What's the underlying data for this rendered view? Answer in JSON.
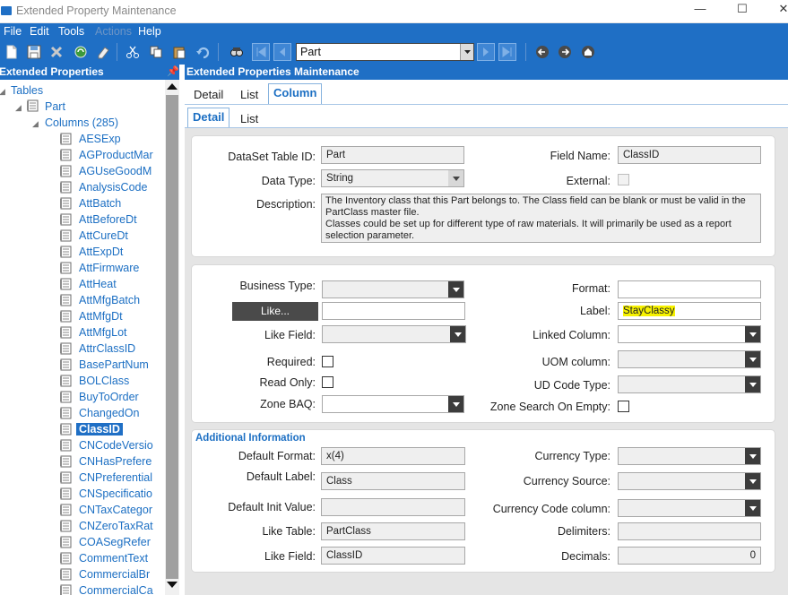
{
  "window": {
    "title": "Extended Property Maintenance",
    "minimize": "—",
    "maximize": "☐",
    "close": "✕"
  },
  "menu": [
    {
      "label": "File",
      "enabled": true
    },
    {
      "label": "Edit",
      "enabled": true
    },
    {
      "label": "Tools",
      "enabled": true
    },
    {
      "label": "Actions",
      "enabled": false
    },
    {
      "label": "Help",
      "enabled": true
    }
  ],
  "toolbar": {
    "combo_value": "Part"
  },
  "left_panel": {
    "title": "Extended Properties",
    "pin": "ᵖ"
  },
  "tree": {
    "root": "Tables",
    "table": "Part",
    "columns_node": "Columns (285)",
    "items": [
      "AESExp",
      "AGProductMar",
      "AGUseGoodM",
      "AnalysisCode",
      "AttBatch",
      "AttBeforeDt",
      "AttCureDt",
      "AttExpDt",
      "AttFirmware",
      "AttHeat",
      "AttMfgBatch",
      "AttMfgDt",
      "AttMfgLot",
      "AttrClassID",
      "BasePartNum",
      "BOLClass",
      "BuyToOrder",
      "ChangedOn",
      "ClassID",
      "CNCodeVersio",
      "CNHasPrefere",
      "CNPreferential",
      "CNSpecificatio",
      "CNTaxCategor",
      "CNZeroTaxRat",
      "COASegRefer",
      "CommentText",
      "CommercialBr",
      "CommercialCa"
    ],
    "selected": "ClassID"
  },
  "right_panel": {
    "title": "Extended Properties Maintenance"
  },
  "tabs_top": [
    {
      "label": "Detail"
    },
    {
      "label": "List"
    },
    {
      "label": "Column",
      "active": true
    }
  ],
  "tabs_sub": [
    {
      "label": "Detail",
      "active": true
    },
    {
      "label": "List"
    }
  ],
  "form": {
    "dataset_table_id_label": "DataSet Table ID:",
    "dataset_table_id": "Part",
    "field_name_label": "Field Name:",
    "field_name": "ClassID",
    "data_type_label": "Data Type:",
    "data_type": "String",
    "external_label": "External:",
    "description_label": "Description:",
    "description": "The Inventory class that this Part belongs to. The Class field can be blank or must be valid in the PartClass master file.\nClasses could be set up for different type of raw materials. It will primarily be used as a report selection parameter.",
    "business_type_label": "Business Type:",
    "business_type": "",
    "format_label": "Format:",
    "format": "",
    "like_button": "Like...",
    "like_value": "",
    "label_label": "Label:",
    "label_value": "StayClassy",
    "like_field_label": "Like Field:",
    "like_field": "",
    "linked_column_label": "Linked Column:",
    "linked_column": "",
    "required_label": "Required:",
    "uom_column_label": "UOM column:",
    "read_only_label": "Read Only:",
    "ud_code_type_label": "UD Code Type:",
    "zone_baq_label": "Zone BAQ:",
    "zone_search_label": "Zone Search On Empty:"
  },
  "additional": {
    "title": "Additional Information",
    "default_format_label": "Default Format:",
    "default_format": "x(4)",
    "currency_type_label": "Currency Type:",
    "default_label_label": "Default Label:",
    "default_label": "Class",
    "currency_source_label": "Currency Source:",
    "default_init_label": "Default Init Value:",
    "default_init": "",
    "currency_code_label": "Currency Code column:",
    "like_table_label": "Like Table:",
    "like_table": "PartClass",
    "delimiters_label": "Delimiters:",
    "like_field_label": "Like Field:",
    "like_field": "ClassID",
    "decimals_label": "Decimals:",
    "decimals": "0"
  },
  "colors": {
    "accent": "#1f6fc5",
    "highlight": "#f7f200",
    "content_bg": "#e5e5e5"
  }
}
